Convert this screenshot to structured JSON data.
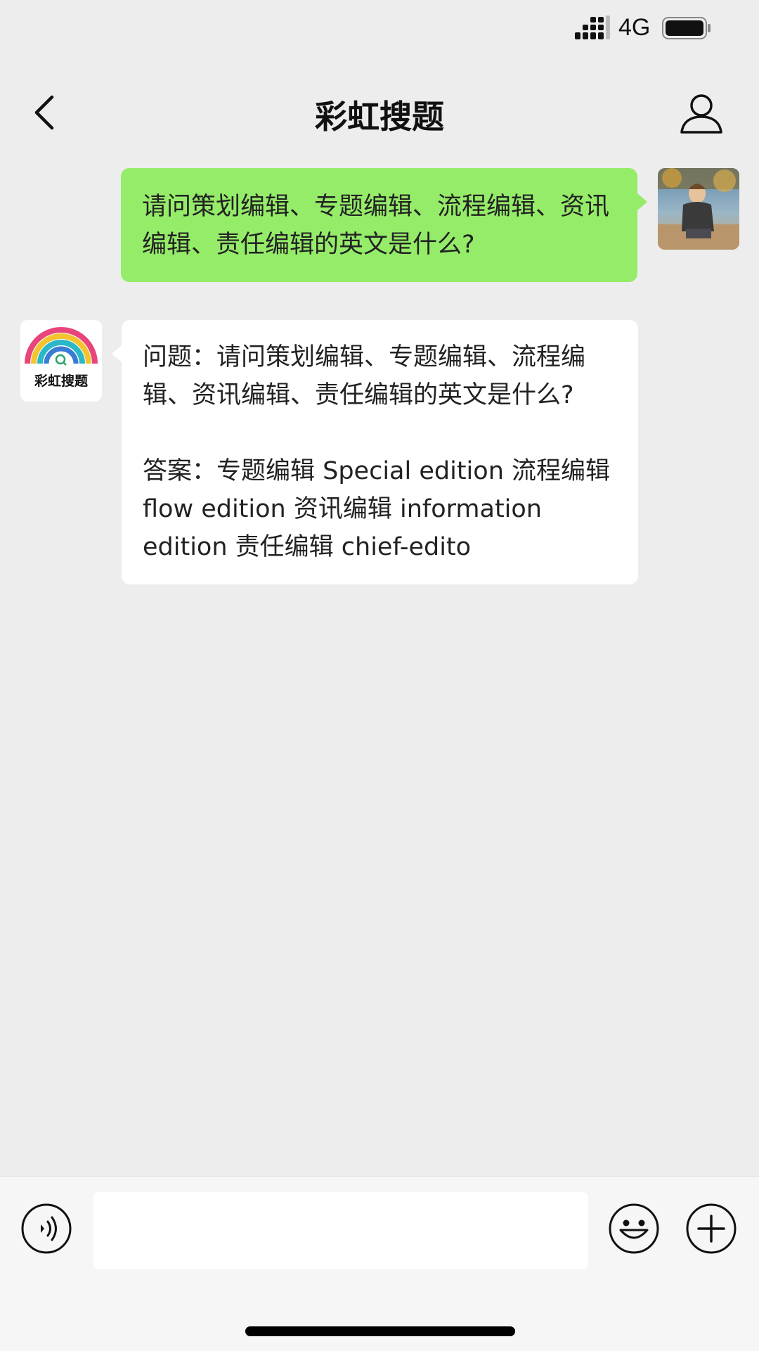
{
  "status_bar": {
    "network": "4G",
    "signal_icon": "signal-bars-icon",
    "battery_icon": "battery-icon"
  },
  "header": {
    "title": "彩虹搜题",
    "back_icon": "chevron-left-icon",
    "profile_icon": "person-icon"
  },
  "messages": [
    {
      "sender": "user",
      "text": "请问策划编辑、专题编辑、流程编辑、资讯编辑、责任编辑的英文是什么?"
    },
    {
      "sender": "bot",
      "bot_logo_text": "彩虹搜题",
      "text": "问题：请问策划编辑、专题编辑、流程编辑、资讯编辑、责任编辑的英文是什么?\n\n答案：专题编辑 Special edition 流程编辑 flow edition 资讯编辑 information edition 责任编辑 chief-edito"
    }
  ],
  "input_bar": {
    "voice_icon": "voice-icon",
    "emoji_icon": "emoji-icon",
    "plus_icon": "plus-icon",
    "input_value": ""
  },
  "colors": {
    "user_bubble": "#95ec69",
    "bot_bubble": "#ffffff",
    "background": "#ededed"
  }
}
